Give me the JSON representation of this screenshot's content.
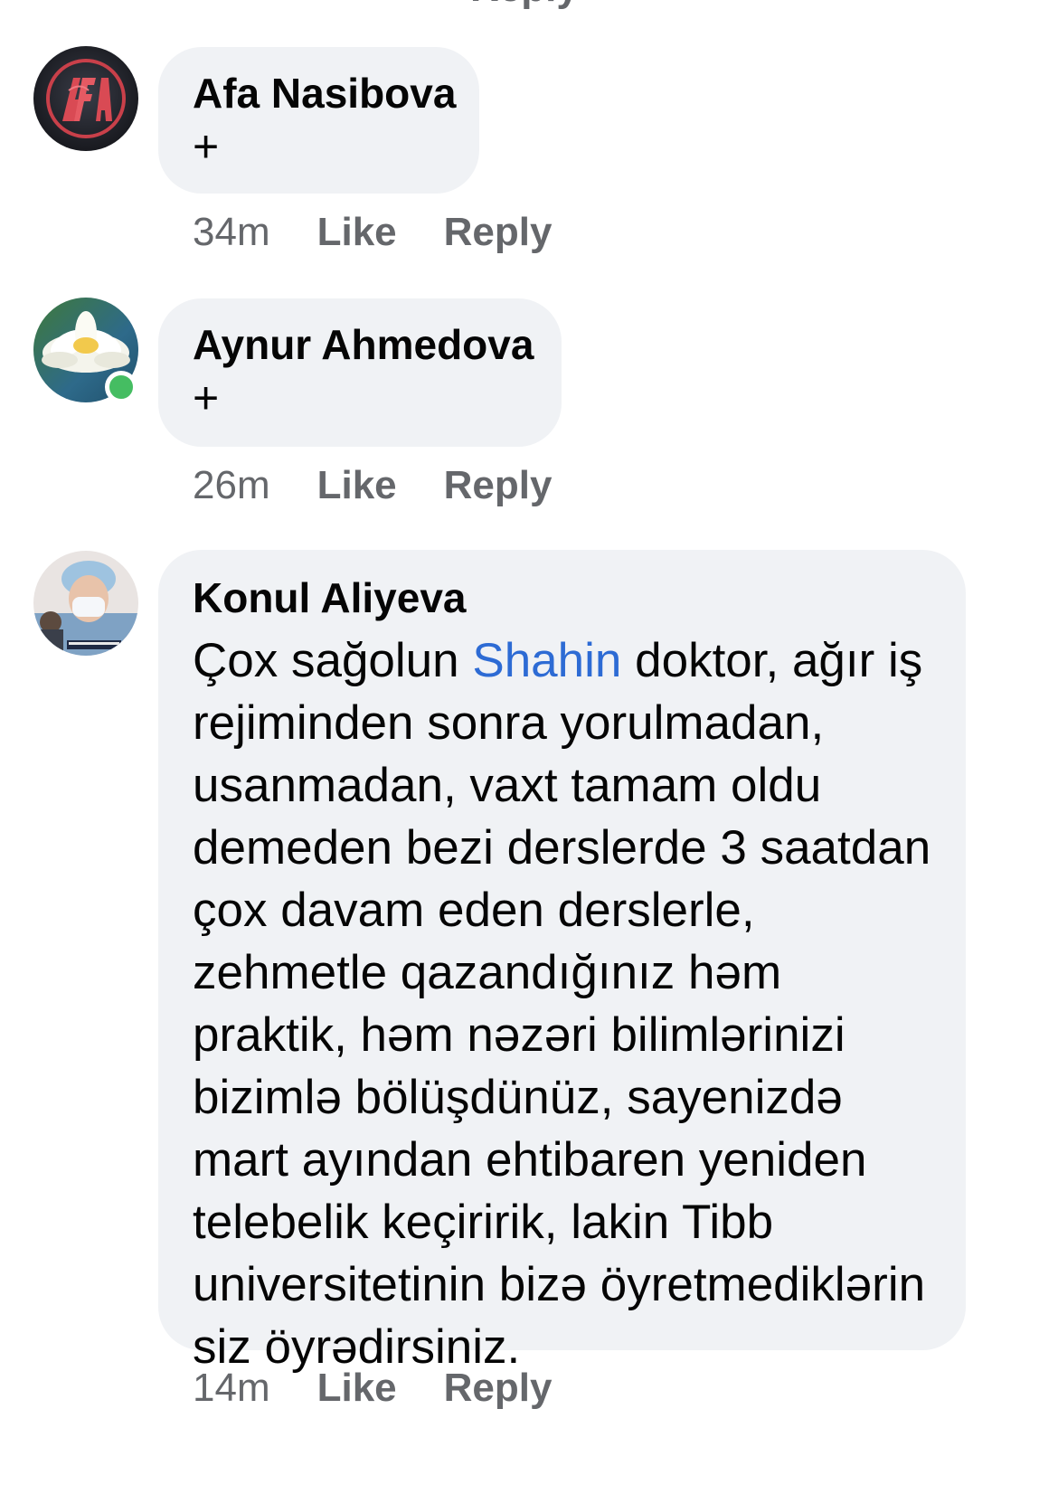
{
  "top_partial": {
    "label": "Reply"
  },
  "comments": [
    {
      "author": "Afa Nasibova",
      "text": "+",
      "time": "34m",
      "like_label": "Like",
      "reply_label": "Reply",
      "avatar_icon": "afa-logo-avatar",
      "online": false
    },
    {
      "author": "Aynur Ahmedova",
      "text": "+",
      "time": "26m",
      "like_label": "Like",
      "reply_label": "Reply",
      "avatar_icon": "water-lily-avatar",
      "online": true
    },
    {
      "author": "Konul Aliyeva",
      "text_before_mention": "Çox sağolun  ",
      "mention": "Shahin",
      "text_after_mention": " doktor, ağır iş rejiminden sonra yorulmadan, usanmadan, vaxt tamam oldu demeden bezi derslerde 3 saatdan çox davam eden derslerle, zehmetle qazandığınız həm praktik, həm nəzəri bilimlərinizi bizimlə bölüşdünüz, sayenizdə mart ayından ehtibaren yeniden telebelik keçiririk, lakin Tibb universitetinin bizə öyretmediklərin siz öyrədirsiniz.",
      "time": "14m",
      "like_label": "Like",
      "reply_label": "Reply",
      "avatar_icon": "nurse-photo-avatar",
      "online": false
    }
  ],
  "colors": {
    "bubble_bg": "#f0f2f5",
    "meta_text": "#65676b",
    "mention": "#2d6bd4",
    "online": "#45bd62"
  }
}
